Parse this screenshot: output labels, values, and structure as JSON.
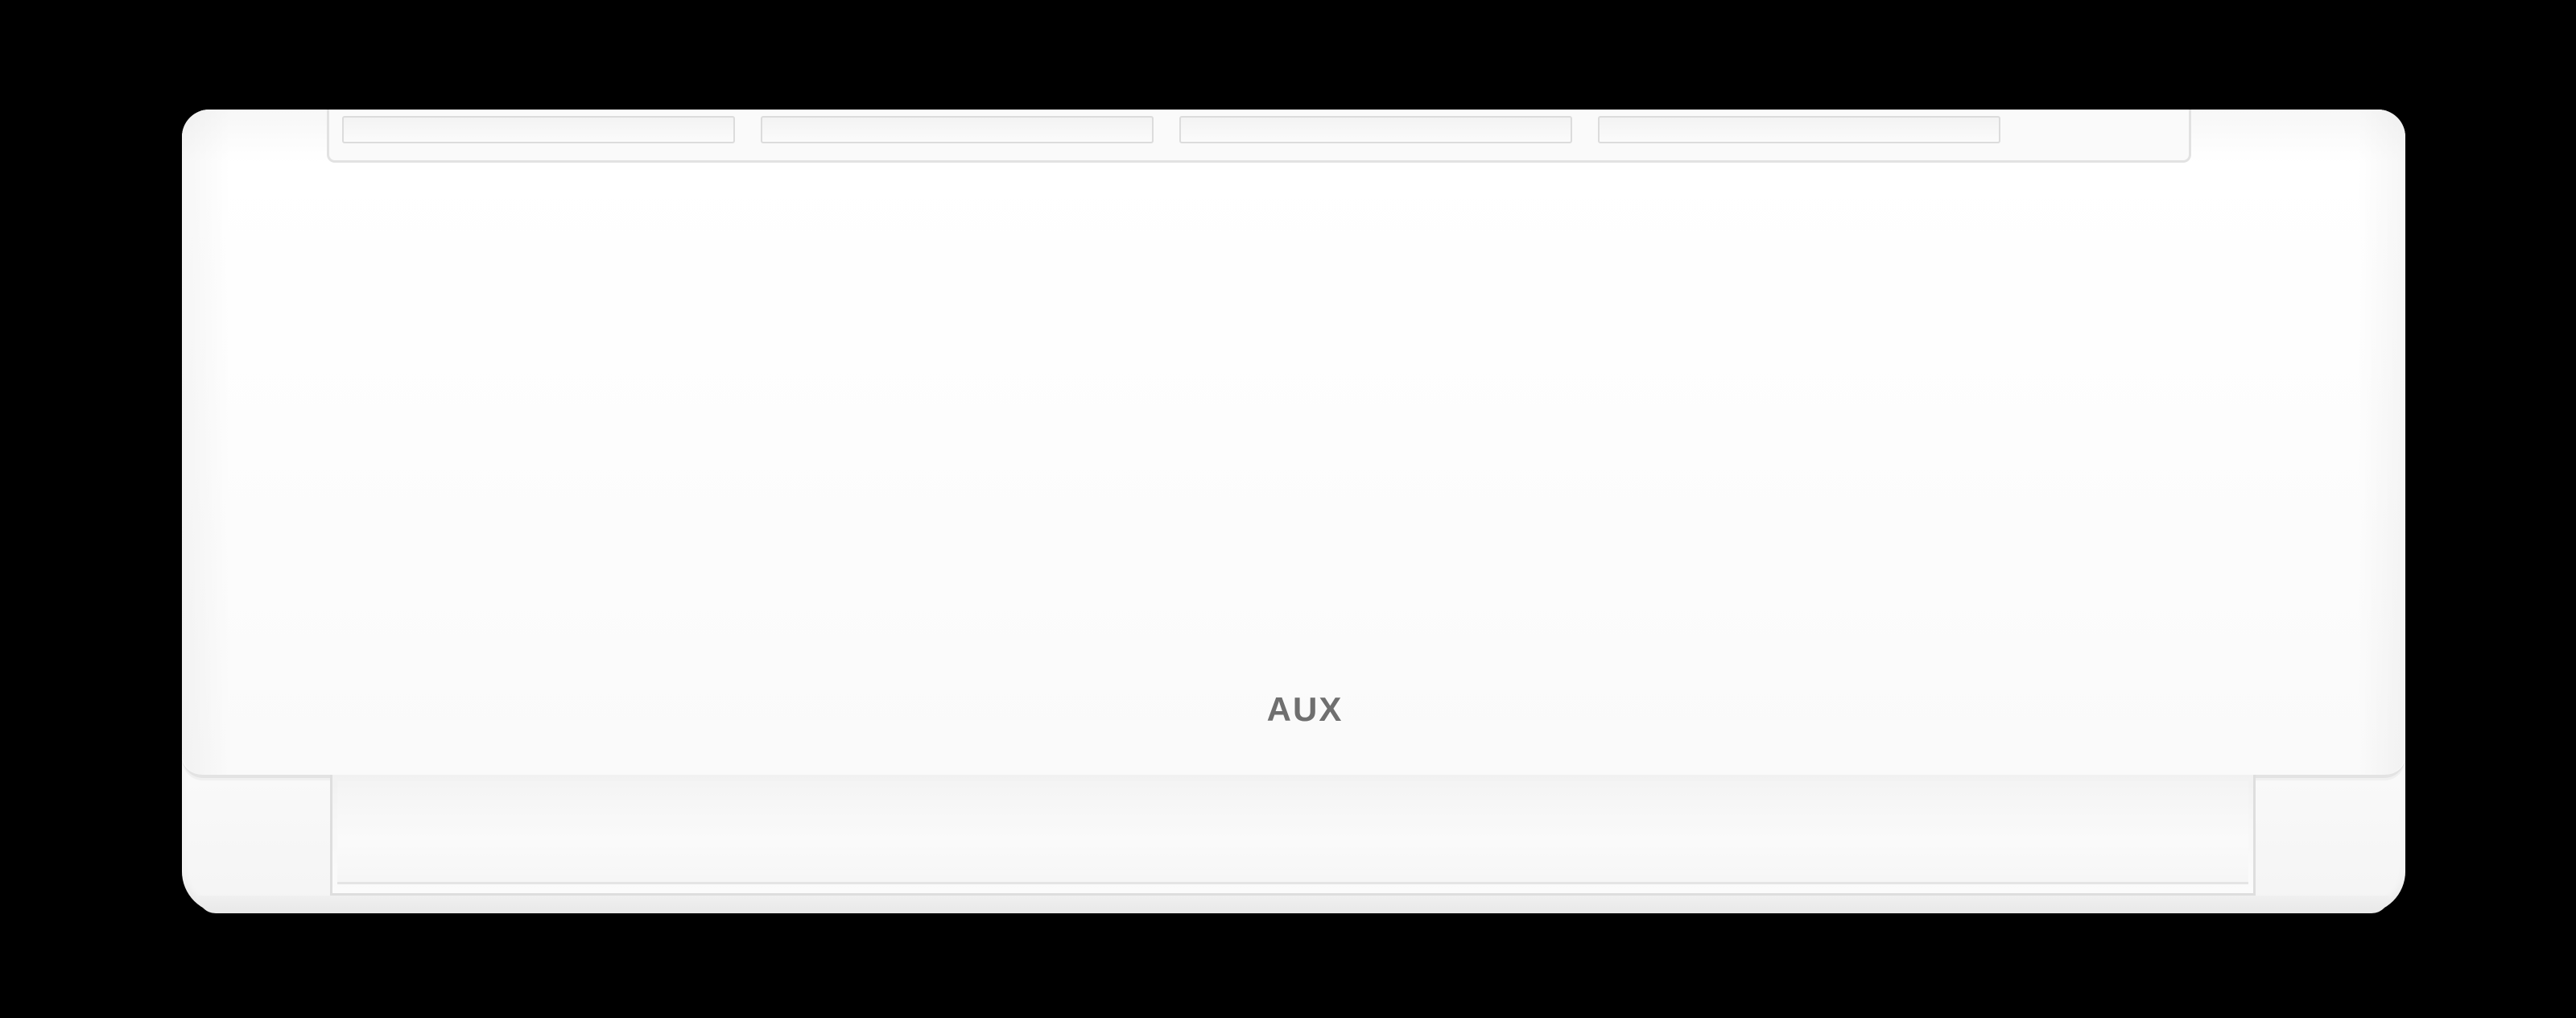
{
  "product": {
    "brand_logo": "AUX"
  },
  "colors": {
    "background": "#000000",
    "unit_body": "#fcfcfc",
    "logo": "#6f6f6f"
  }
}
